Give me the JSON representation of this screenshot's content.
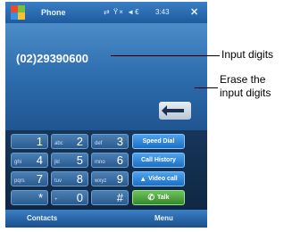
{
  "titlebar": {
    "app_title": "Phone",
    "status_icons": "⇄ Ÿ× ◄€",
    "time": "3:43",
    "close_label": "✕"
  },
  "display": {
    "number": "(02)29390600",
    "erase_icon": "erase-icon"
  },
  "keypad": {
    "keys": [
      {
        "letters": "",
        "digit": "1"
      },
      {
        "letters": "abc",
        "digit": "2"
      },
      {
        "letters": "def",
        "digit": "3"
      },
      {
        "letters": "ghi",
        "digit": "4"
      },
      {
        "letters": "jkl",
        "digit": "5"
      },
      {
        "letters": "mno",
        "digit": "6"
      },
      {
        "letters": "pqrs",
        "digit": "7"
      },
      {
        "letters": "tuv",
        "digit": "8"
      },
      {
        "letters": "wxyz",
        "digit": "9"
      },
      {
        "letters": "",
        "digit": "*"
      },
      {
        "letters": "+",
        "digit": "0"
      },
      {
        "letters": "",
        "digit": "#"
      }
    ],
    "function_buttons": {
      "speed_dial": "Speed Dial",
      "call_history": "Call History",
      "video_call": "Video call",
      "talk": "Talk"
    }
  },
  "softbar": {
    "left": "Contacts",
    "right": "Menu"
  },
  "annotations": {
    "input_digits": "Input digits",
    "erase_line1": "Erase the",
    "erase_line2": "input digits"
  },
  "colors": {
    "accent": "#2b6aab",
    "talk_green": "#35882a",
    "function_blue": "#1c6fc2"
  }
}
